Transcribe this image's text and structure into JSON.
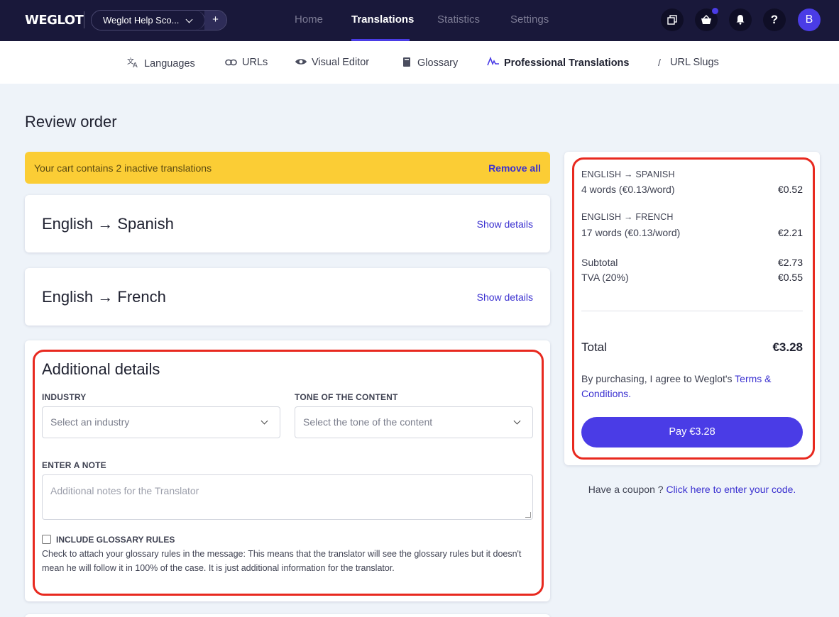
{
  "app": {
    "logo": "WEGLOT",
    "project_name": "Weglot Help Sco...",
    "project_add": "+",
    "avatar_initial": "B"
  },
  "nav": {
    "home": "Home",
    "translations": "Translations",
    "statistics": "Statistics",
    "settings": "Settings"
  },
  "subnav": {
    "languages": "Languages",
    "urls": "URLs",
    "visual_editor": "Visual Editor",
    "glossary": "Glossary",
    "professional_translations": "Professional Translations",
    "url_slugs": "URL Slugs"
  },
  "page": {
    "title": "Review order"
  },
  "banner": {
    "text": "Your cart contains 2 inactive translations",
    "action": "Remove all"
  },
  "orders": [
    {
      "title": "English → Spanish",
      "action": "Show details"
    },
    {
      "title": "English → French",
      "action": "Show details"
    }
  ],
  "details": {
    "title": "Additional details",
    "industry_label": "INDUSTRY",
    "industry_placeholder": "Select an industry",
    "tone_label": "TONE OF THE CONTENT",
    "tone_placeholder": "Select the tone of the content",
    "note_label": "ENTER A NOTE",
    "note_placeholder": "Additional notes for the Translator",
    "glossary_label": "INCLUDE GLOSSARY RULES",
    "glossary_help": "Check to attach your glossary rules in the message: This means that the translator will see the glossary rules but it doesn't mean he will follow it in 100% of the case. It is just additional information for the translator."
  },
  "summary": {
    "items": [
      {
        "pair": "ENGLISH → SPANISH",
        "detail": "4 words (€0.13/word)",
        "price": "€0.52"
      },
      {
        "pair": "ENGLISH → FRENCH",
        "detail": "17 words (€0.13/word)",
        "price": "€2.21"
      }
    ],
    "subtotal_label": "Subtotal",
    "subtotal_value": "€2.73",
    "tax_label": "TVA (20%)",
    "tax_value": "€0.55",
    "total_label": "Total",
    "total_value": "€3.28",
    "terms_prefix": "By purchasing, I agree to Weglot's",
    "terms_link": "Terms & Conditions.",
    "pay_label": "Pay €3.28"
  },
  "coupon": {
    "prefix": "Have a coupon ?",
    "link": "Click here to enter your code."
  },
  "colors": {
    "accent": "#4a3ce6",
    "topbar": "#19183a",
    "banner": "#fbcd35",
    "highlight": "#e8291f"
  }
}
